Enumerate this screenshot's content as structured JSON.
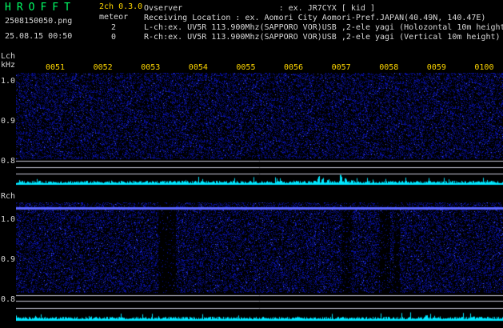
{
  "header": {
    "brand": "HROFFT",
    "version": "2ch 0.3.0",
    "filename": "2508150050.png",
    "mode_label": "meteor",
    "datetime": "25.08.15 00:50",
    "count_l": "2",
    "count_r": "0",
    "observer_line": "Ovserver                    : ex. JR7CYX [ kid ]",
    "location_line": "Receiving Location : ex. Aomori City Aomori-Pref.JAPAN(40.49N, 140.47E)",
    "lch_line": "L-ch:ex. UV5R 113.900Mhz(SAPPORO VOR)USB ,2-ele yagi (Holozontal 10m height)",
    "rch_line": "R-ch:ex. UV5R 113.900Mhz(SAPPORO VOR)USB ,2-ele yagi (Vertical 10m height)"
  },
  "lch": {
    "label": "Lch",
    "unit": "kHz",
    "y_ticks": [
      "1.0",
      "0.9",
      "0.8"
    ]
  },
  "rch": {
    "label": "Rch",
    "y_ticks": [
      "1.0",
      "0.9",
      "0.8"
    ]
  },
  "time_ticks": [
    "0051",
    "0052",
    "0053",
    "0054",
    "0055",
    "0056",
    "0057",
    "0058",
    "0059",
    "0100"
  ],
  "colors": {
    "background": "#000000",
    "noise_blue": "#1c2ccc",
    "carrier": "#6f7cff",
    "spectrum_line": "#00e6ff",
    "tick_text": "#ffd700",
    "brand_green": "#00ff66"
  }
}
